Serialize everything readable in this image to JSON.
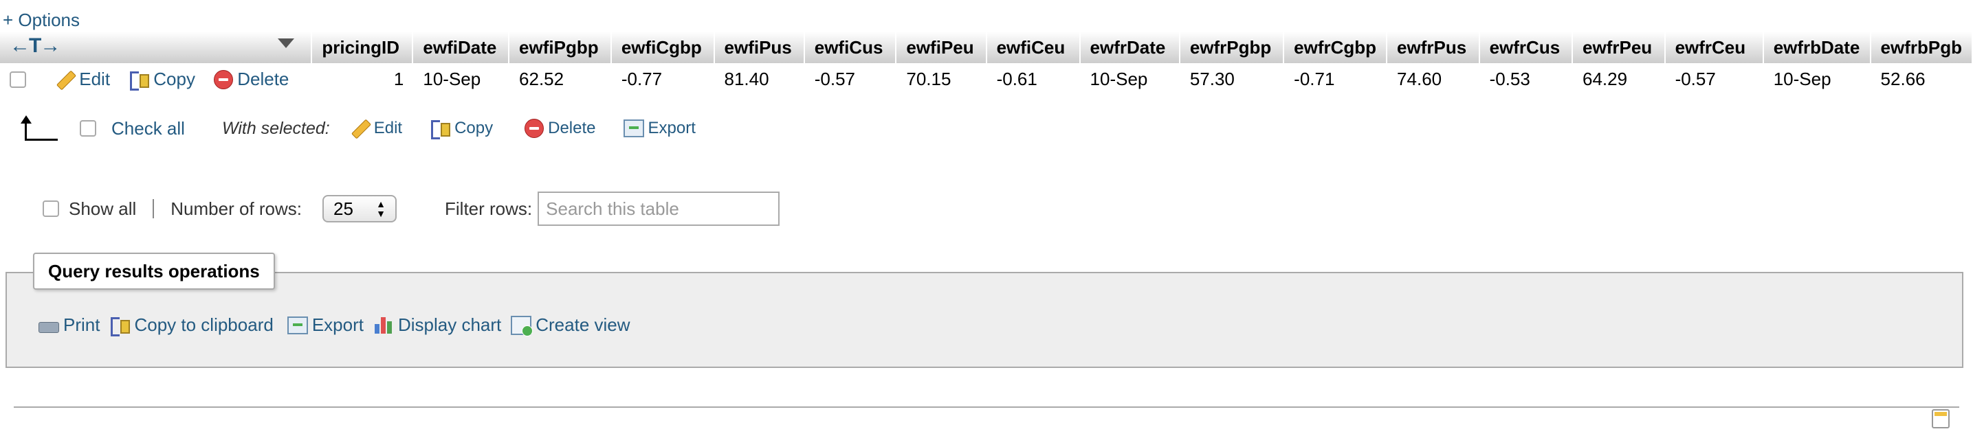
{
  "options_link": "+ Options",
  "table": {
    "sort_arrows": "←T→",
    "columns": [
      "pricingID",
      "ewfiDate",
      "ewfiPgbp",
      "ewfiCgbp",
      "ewfiPus",
      "ewfiCus",
      "ewfiPeu",
      "ewfiCeu",
      "ewfrDate",
      "ewfrPgbp",
      "ewfrCgbp",
      "ewfrPus",
      "ewfrCus",
      "ewfrPeu",
      "ewfrCeu",
      "ewfrbDate",
      "ewfrbPgb"
    ],
    "row_actions": {
      "edit": "Edit",
      "copy": "Copy",
      "delete": "Delete"
    },
    "rows": [
      [
        "1",
        "10-Sep",
        "62.52",
        "-0.77",
        "81.40",
        "-0.57",
        "70.15",
        "-0.61",
        "10-Sep",
        "57.30",
        "-0.71",
        "74.60",
        "-0.53",
        "64.29",
        "-0.57",
        "10-Sep",
        "52.66"
      ]
    ]
  },
  "with_selected": {
    "check_all": "Check all",
    "label": "With selected:",
    "edit": "Edit",
    "copy": "Copy",
    "delete": "Delete",
    "export": "Export"
  },
  "navigation": {
    "show_all": "Show all",
    "rows_label": "Number of rows:",
    "rows_value": "25",
    "filter_label": "Filter rows:",
    "filter_placeholder": "Search this table"
  },
  "operations": {
    "title": "Query results operations",
    "print": "Print",
    "copy_clipboard": "Copy to clipboard",
    "export": "Export",
    "display_chart": "Display chart",
    "create_view": "Create view"
  },
  "colors": {
    "link": "#235a81",
    "header_gradient_bottom": "#cccccc",
    "ops_background": "#eeeeee"
  }
}
